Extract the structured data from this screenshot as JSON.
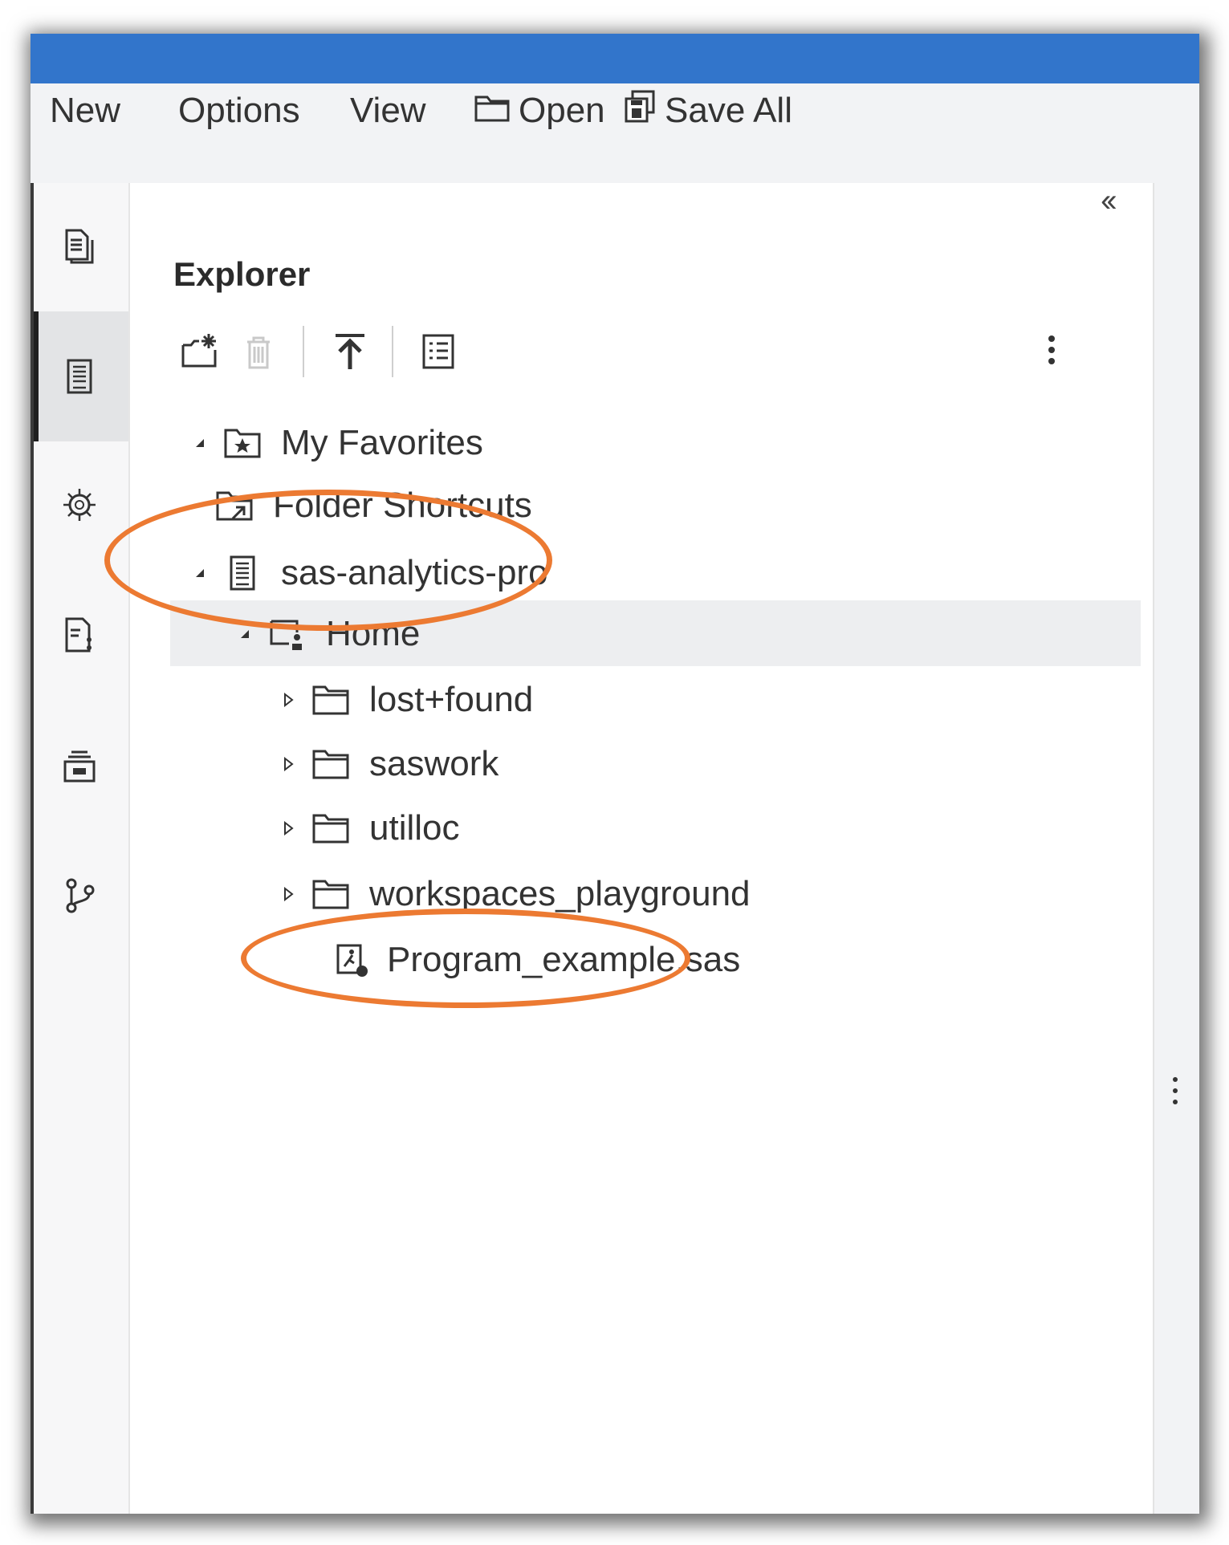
{
  "menu": {
    "new_label": "New",
    "options_label": "Options",
    "view_label": "View",
    "open_label": "Open",
    "save_all_label": "Save All"
  },
  "explorer": {
    "title": "Explorer"
  },
  "tree": {
    "favorites": "My Favorites",
    "folder_shortcuts": "Folder Shortcuts",
    "server": "sas-analytics-pro",
    "home": "Home",
    "folders": [
      "lost+found",
      "saswork",
      "utilloc",
      "workspaces_playground"
    ],
    "program_file": "Program_example.sas"
  },
  "colors": {
    "titlebar": "#3275cb",
    "highlight": "#ec7a32",
    "selected_row": "#edeef0"
  }
}
